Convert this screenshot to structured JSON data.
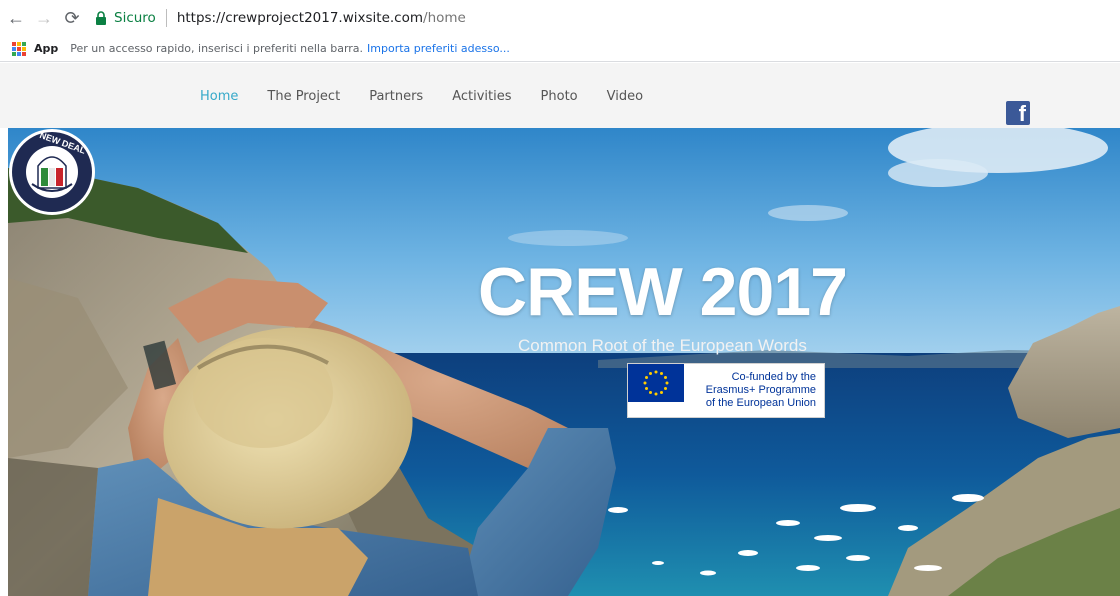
{
  "browser": {
    "back_icon": "arrow-left-icon",
    "forward_icon": "arrow-right-icon",
    "reload_icon": "reload-icon",
    "secure_label": "Sicuro",
    "url_host": "https://crewproject2017.wixsite.com",
    "url_path": "/home",
    "bookmarks": {
      "apps_label": "App",
      "hint": "Per un accesso rapido, inserisci i preferiti nella barra.",
      "import_link": "Importa preferiti adesso..."
    }
  },
  "site": {
    "menu": [
      {
        "label": "Home",
        "active": true
      },
      {
        "label": "The Project",
        "active": false
      },
      {
        "label": "Partners",
        "active": false
      },
      {
        "label": "Activities",
        "active": false
      },
      {
        "label": "Photo",
        "active": false
      },
      {
        "label": "Video",
        "active": false
      }
    ],
    "facebook_icon": "facebook-icon",
    "hero": {
      "title": "CREW 2017",
      "subtitle": "Common Root of the European Words",
      "erasmus": {
        "line1": "Co-funded by the",
        "line2": "Erasmus+ Programme",
        "line3": "of the European Union"
      },
      "badge_text": "NEW DEAL",
      "badge_sub": "Associazione di Volontariato"
    }
  },
  "colors": {
    "menu_active": "#36a9c9",
    "header_bg": "#f4f4f4",
    "secure_green": "#0b8043",
    "facebook_blue": "#3b5998",
    "eu_blue": "#003399"
  }
}
